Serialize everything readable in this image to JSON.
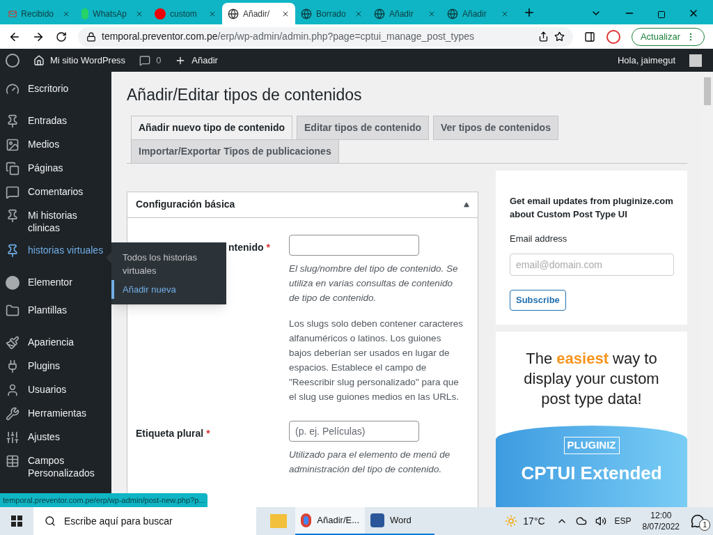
{
  "browser": {
    "tabs": [
      {
        "title": "Recibido",
        "selected": false
      },
      {
        "title": "WhatsAp",
        "selected": false
      },
      {
        "title": "custom",
        "selected": false
      },
      {
        "title": "Añadir/",
        "selected": true
      },
      {
        "title": "Borrado",
        "selected": false
      },
      {
        "title": "Añadir",
        "selected": false
      },
      {
        "title": "Añadir",
        "selected": false
      }
    ],
    "url_host": "temporal.preventor.com.pe",
    "url_path": "/erp/wp-admin/admin.php?page=cptui_manage_post_types",
    "update_button": "Actualizar"
  },
  "admin_bar": {
    "site": "Mi sitio WordPress",
    "comments": "0",
    "add": "Añadir",
    "greeting": "Hola, jaimegut"
  },
  "sidebar": {
    "items": [
      {
        "label": "Escritorio",
        "selected": false
      },
      {
        "label": "Entradas",
        "selected": false
      },
      {
        "label": "Medios",
        "selected": false
      },
      {
        "label": "Páginas",
        "selected": false
      },
      {
        "label": "Comentarios",
        "selected": false
      },
      {
        "label": "Mi historias clinicas",
        "selected": false
      },
      {
        "label": "historias virtuales",
        "selected": true
      },
      {
        "label": "Elementor",
        "selected": false
      },
      {
        "label": "Plantillas",
        "selected": false
      },
      {
        "label": "Apariencia",
        "selected": false
      },
      {
        "label": "Plugins",
        "selected": false
      },
      {
        "label": "Usuarios",
        "selected": false
      },
      {
        "label": "Herramientas",
        "selected": false
      },
      {
        "label": "Ajustes",
        "selected": false
      },
      {
        "label": "Campos Personalizados",
        "selected": false
      }
    ],
    "flyout": [
      {
        "label": "Todos los historias virtuales",
        "selected": false
      },
      {
        "label": "Añadir nueva",
        "selected": true
      }
    ]
  },
  "page": {
    "title": "Añadir/Editar tipos de contenidos",
    "tabs": [
      {
        "label": "Añadir nuevo tipo de contenido",
        "selected": true
      },
      {
        "label": "Editar tipos de contenido",
        "selected": false
      },
      {
        "label": "Ver tipos de contenidos",
        "selected": false
      },
      {
        "label": "Importar/Exportar Tipos de publicaciones",
        "selected": false
      }
    ],
    "panel": {
      "title": "Configuración básica",
      "expanded": true,
      "fields": [
        {
          "label": "ntenido",
          "required": "*",
          "help": [
            "El slug/nombre del tipo de contenido. Se utiliza en varias consultas de contenido de tipo de contenido.",
            "Los slugs solo deben contener caracteres alfanuméricos o latinos. Los guiones bajos deberían ser usados en lugar de espacios. Establece el campo de \"Reescribir slug personalizado\" para que el slug use guiones medios en las URLs."
          ]
        },
        {
          "label": "Etiqueta plural",
          "required": "*",
          "placeholder": "(p. ej. Películas)",
          "help": [
            "Utilizado para el elemento de menú de administración del tipo de contenido."
          ]
        }
      ]
    },
    "newsletter": {
      "text": "Get email updates from pluginize.com about Custom Post Type UI",
      "email_label": "Email address",
      "placeholder": "email@domain.com",
      "button": "Subscribe"
    },
    "ad": {
      "headline": "The **easiest** way to display your custom post type data!",
      "brand": "PLUGINIZ",
      "product": "CPTUI Extended"
    }
  },
  "status_url": "temporal.preventor.com.pe/erp/wp-admin/post-new.php?p...",
  "taskbar": {
    "search": "Escribe aquí para buscar",
    "apps": [
      {
        "label": "Añadir/E...",
        "selected": true
      },
      {
        "label": "Word",
        "selected": false
      }
    ],
    "temperature": "17°C",
    "language": "ESP",
    "time": "12:00",
    "date": "8/07/2022",
    "notifications": "1"
  }
}
